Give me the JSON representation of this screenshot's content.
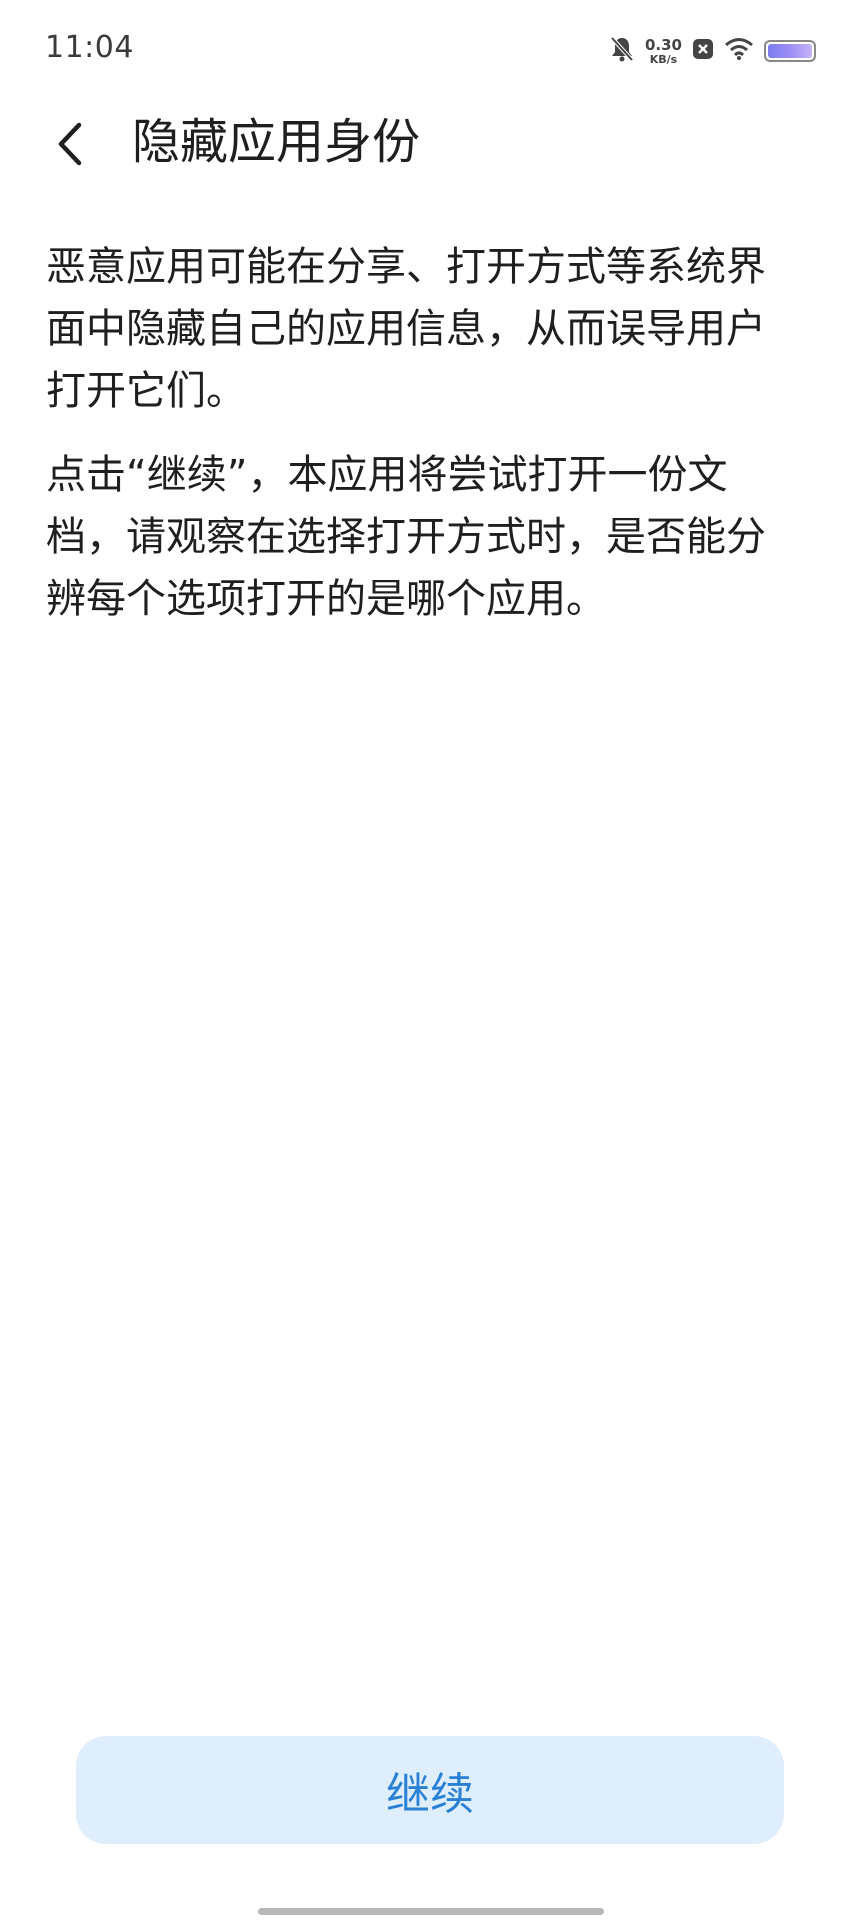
{
  "status_bar": {
    "time": "11:04",
    "net_speed_value": "0.30",
    "net_speed_unit": "KB/s",
    "icons": [
      "bell-muted-icon",
      "close-badge-icon",
      "wifi-icon",
      "battery-icon"
    ],
    "battery_color": "#8f88f3"
  },
  "header": {
    "back_icon": "chevron-left-icon",
    "title": "隐藏应用身份"
  },
  "content": {
    "paragraphs": [
      "恶意应用可能在分享、打开方式等系统界面中隐藏自己的应用信息，从而误导用户打开它们。",
      "点击“继续”，本应用将尝试打开一份文档，请观察在选择打开方式时，是否能分辨每个选项打开的是哪个应用。"
    ]
  },
  "actions": {
    "continue_label": "继续",
    "accent_color": "#2a7fd6",
    "button_bg": "#dfeefc"
  }
}
